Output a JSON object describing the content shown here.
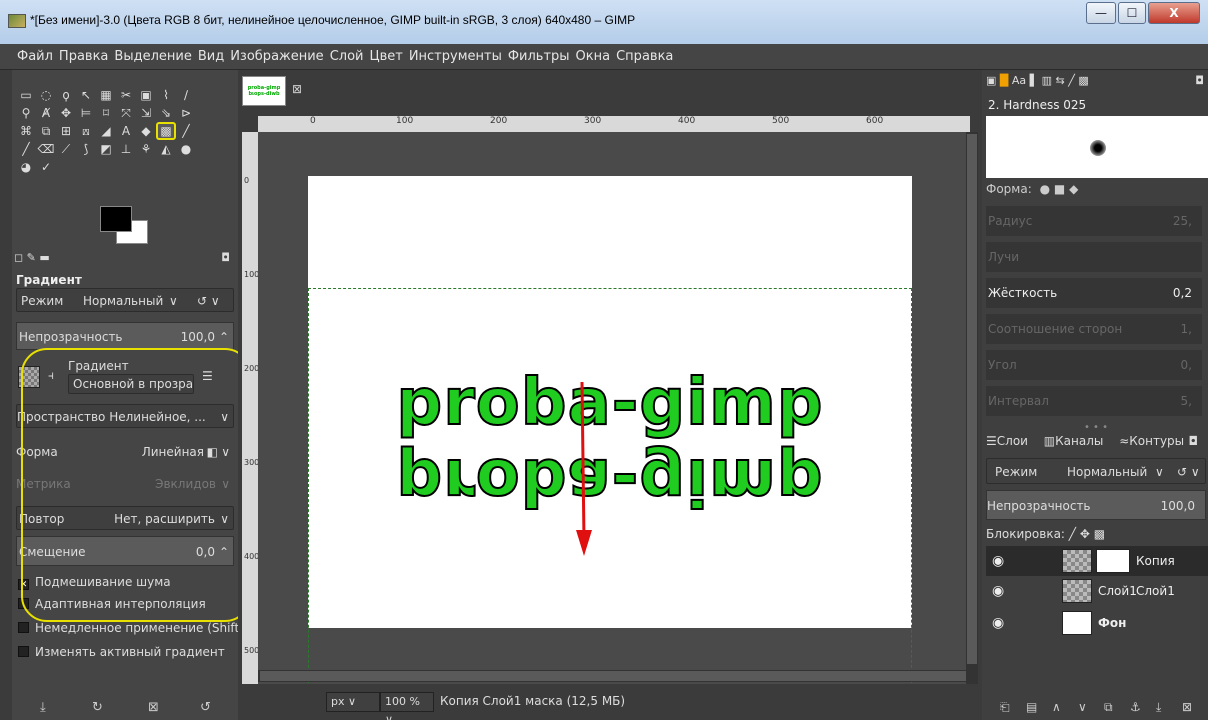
{
  "window": {
    "title": "*[Без имени]-3.0 (Цвета RGB 8 бит, нелинейное целочисленное, GIMP built-in sRGB, 3 слоя) 640x480 – GIMP",
    "min": "—",
    "max": "☐",
    "close": "X"
  },
  "menu": [
    "Файл",
    "Правка",
    "Выделение",
    "Вид",
    "Изображение",
    "Слой",
    "Цвет",
    "Инструменты",
    "Фильтры",
    "Окна",
    "Справка"
  ],
  "tool_options": {
    "title": "Градиент",
    "mode_label": "Режим",
    "mode_value": "Нормальный",
    "opacity_label": "Непрозрачность",
    "opacity_value": "100,0",
    "gradient_label": "Градиент",
    "gradient_value": "Основной в прозрач",
    "space_label": "Пространство Нелинейное, ...",
    "shape_label": "Форма",
    "shape_value": "Линейная",
    "metric_label": "Метрика",
    "metric_value": "Эвклидов",
    "repeat_label": "Повтор",
    "repeat_value": "Нет, расширить",
    "offset_label": "Смещение",
    "offset_value": "0,0",
    "dither_label": "Подмешивание шума",
    "adaptive_label": "Адаптивная интерполяция",
    "instant_label": "Немедленное применение (Shift)",
    "modify_label": "Изменять активный градиент"
  },
  "canvas": {
    "tab_thumb_line1": "proba-gimp",
    "tab_thumb_line2": "bιops-diwb",
    "text_upper": "proba-gimp",
    "text_lower": "proba-gimp",
    "ruler_labels": [
      "0",
      "100",
      "200",
      "300",
      "400",
      "500",
      "600"
    ],
    "vruler_labels": [
      "0",
      "100",
      "200",
      "300",
      "400",
      "500"
    ]
  },
  "status": {
    "unit": "px",
    "zoom": "100 %",
    "message": "Копия Слой1 маска (12,5 МБ)"
  },
  "brushes": {
    "name": "2. Hardness 025",
    "shape_label": "Форма:",
    "radius_label": "Радиус",
    "radius_value": "25,",
    "spikes_label": "Лучи",
    "spikes_value": "",
    "hardness_label": "Жёсткость",
    "hardness_value": "0,2",
    "aspect_label": "Соотношение сторон",
    "aspect_value": "1,",
    "angle_label": "Угол",
    "angle_value": "0,",
    "spacing_label": "Интервал",
    "spacing_value": "5,"
  },
  "layers_dock": {
    "tab_layers": "Слои",
    "tab_channels": "Каналы",
    "tab_paths": "Контуры",
    "mode_label": "Режим",
    "mode_value": "Нормальный",
    "opacity_label": "Непрозрачность",
    "opacity_value": "100,0",
    "lock_label": "Блокировка:",
    "layers": [
      {
        "name": "Копия Слой1"
      },
      {
        "name": "Слой1"
      },
      {
        "name": "Фон"
      }
    ]
  },
  "colors": {
    "text_green": "#1fcc1f",
    "highlight_yellow": "#e8e000",
    "arrow_red": "#e01010"
  }
}
